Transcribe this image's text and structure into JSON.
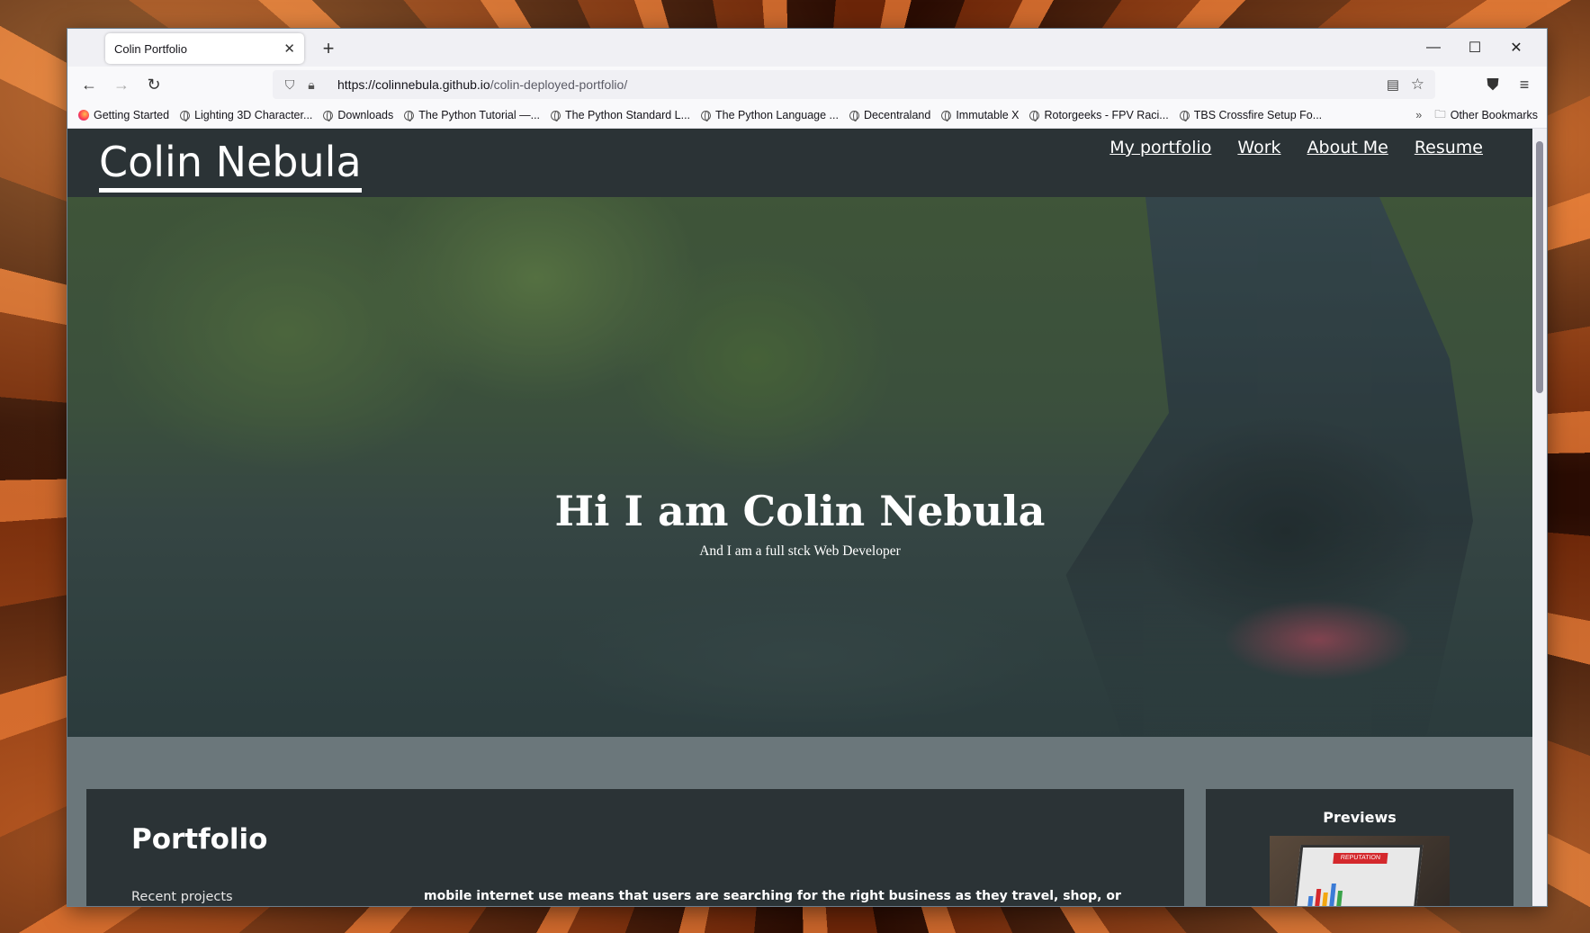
{
  "browser": {
    "tab_title": "Colin Portfolio",
    "url_host": "https://colinnebula.github.io",
    "url_path": "/colin-deployed-portfolio/",
    "bookmarks": [
      "Getting Started",
      "Lighting 3D Character...",
      "Downloads",
      "The Python Tutorial —...",
      "The Python Standard L...",
      "The Python Language ...",
      "Decentraland",
      "Immutable X",
      "Rotorgeeks - FPV Raci...",
      "TBS Crossfire Setup Fo..."
    ],
    "other_bookmarks": "Other Bookmarks"
  },
  "site": {
    "brand": "Colin Nebula",
    "nav": [
      "My portfolio",
      "Work",
      "About Me",
      "Resume"
    ],
    "hero_title": "Hi I am Colin Nebula",
    "hero_subtitle": "And I am a full stck Web Developer",
    "portfolio_heading": "Portfolio",
    "recent_projects": "Recent projects",
    "body_text": "mobile internet use means that users are searching for the right business as they travel, shop, or sit on their couch at home. Search Engine Optimization (SEO) allows you to increase your visibility and find the right customers for your business.",
    "previews_heading": "Previews",
    "preview_badge": "REPUTATION"
  }
}
